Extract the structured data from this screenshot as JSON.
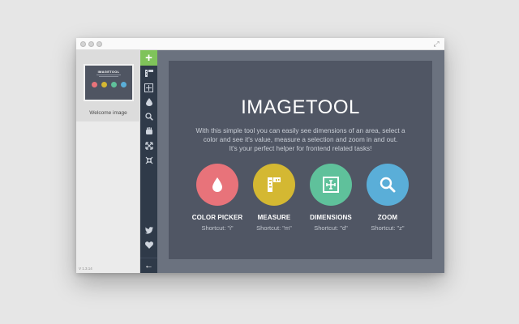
{
  "window": {
    "controls": [
      "close",
      "minimize",
      "maximize"
    ],
    "expand_icon": "expand-icon"
  },
  "sidebar": {
    "thumbnail_title": "IMAGETOOL",
    "thumbnail_label": "Welcome image",
    "version": "V 1.3.14"
  },
  "toolbar": {
    "add_icon": "plus",
    "tools": [
      "measure-icon",
      "dimensions-icon",
      "color-picker-icon",
      "zoom-icon",
      "hand-icon",
      "expand-arrows-icon",
      "collapse-arrows-icon",
      "twitter-icon",
      "heart-icon"
    ],
    "back_icon": "arrow-left",
    "accent": "#7fc35a",
    "background": "#2f3a49"
  },
  "main": {
    "title": "IMAGETOOL",
    "description_lines": [
      "With this simple tool you can easily see dimensions of an area, select a",
      "color and see it's value, measure a selection and zoom in and out.",
      "It's your perfect helper for frontend related tasks!"
    ],
    "features": [
      {
        "label": "COLOR PICKER",
        "shortcut": "Shortcut: \"i\"",
        "color": "#e8737a",
        "icon": "drop-icon"
      },
      {
        "label": "MEASURE",
        "shortcut": "Shortcut: \"m\"",
        "color": "#d4b832",
        "icon": "ruler-icon"
      },
      {
        "label": "DIMENSIONS",
        "shortcut": "Shortcut: \"d\"",
        "color": "#5fc19b",
        "icon": "dimensions-icon"
      },
      {
        "label": "ZOOM",
        "shortcut": "Shortcut: \"z\"",
        "color": "#5aaed8",
        "icon": "magnifier-icon"
      }
    ]
  }
}
